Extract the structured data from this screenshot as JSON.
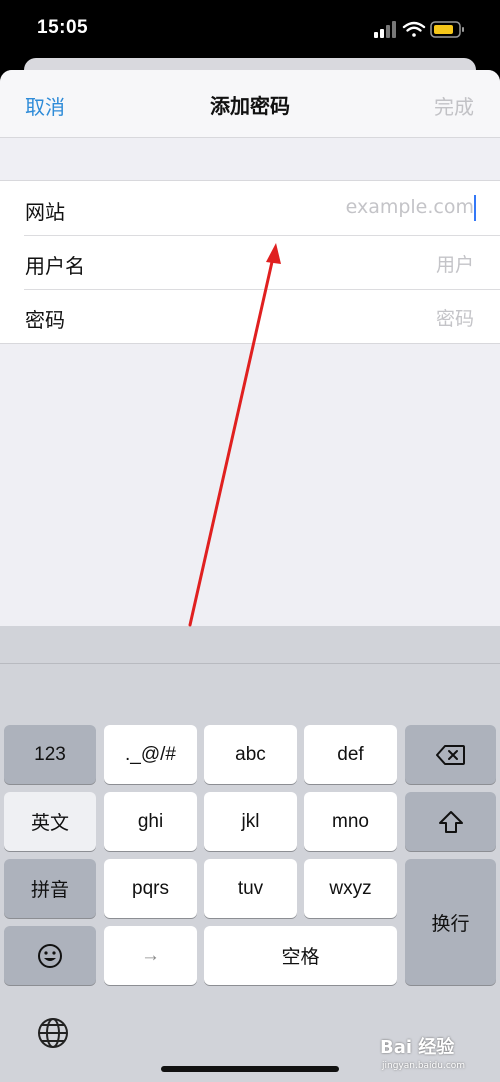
{
  "status": {
    "time": "15:05"
  },
  "nav": {
    "cancel": "取消",
    "title": "添加密码",
    "done": "完成"
  },
  "form": {
    "rows": [
      {
        "label": "网站",
        "placeholder": "example.com"
      },
      {
        "label": "用户名",
        "placeholder": "用户"
      },
      {
        "label": "密码",
        "placeholder": "密码"
      }
    ]
  },
  "keyboard": {
    "k123": "123",
    "punct": "._@/#",
    "abc": "abc",
    "def": "def",
    "english": "英文",
    "ghi": "ghi",
    "jkl": "jkl",
    "mno": "mno",
    "pinyin": "拼音",
    "pqrs": "pqrs",
    "tuv": "tuv",
    "wxyz": "wxyz",
    "return": "换行",
    "arrow": "→",
    "space": "空格"
  },
  "watermark": {
    "brand": "Bai 经验",
    "sub": "jingyan.baidu.com"
  },
  "colors": {
    "accent": "#2e8bd8",
    "annotation": "#e02020"
  },
  "icons": [
    "signal-icon",
    "wifi-icon",
    "battery-icon",
    "backspace-icon",
    "shift-icon",
    "emoji-icon",
    "globe-icon"
  ]
}
